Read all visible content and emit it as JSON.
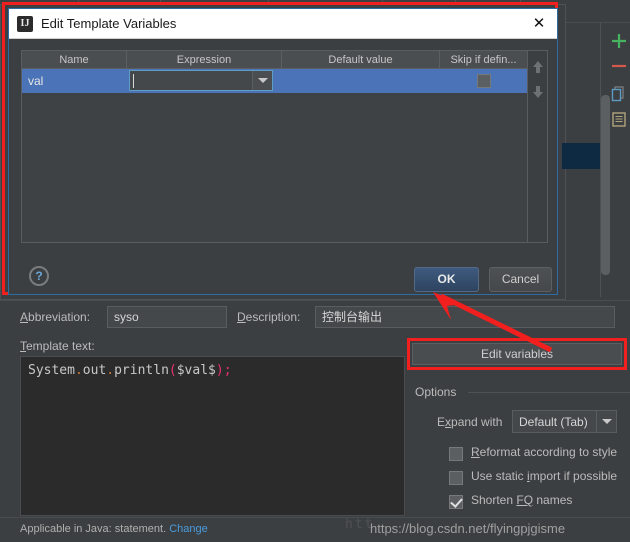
{
  "dialog": {
    "title": "Edit Template Variables",
    "app_icon": "IJ",
    "close_icon": "close-icon",
    "table": {
      "columns": [
        "Name",
        "Expression",
        "Default value",
        "Skip if defin..."
      ],
      "rows": [
        {
          "name": "val",
          "expression": "",
          "default_value": "",
          "skip_if_defined": false
        }
      ]
    },
    "side_buttons": [
      "move-up-arrow",
      "move-down-arrow"
    ],
    "help_label": "?",
    "ok_label": "OK",
    "cancel_label": "Cancel"
  },
  "form": {
    "abbreviation_label": "Abbreviation:",
    "abbreviation_value": "syso",
    "description_label": "Description:",
    "description_value": "控制台输出",
    "template_text_label": "Template text:",
    "template_code": {
      "part1": "System",
      "dot1": ".",
      "part2": "out",
      "dot2": ".",
      "part3": "println",
      "paren_open": "(",
      "variable": "$val$",
      "paren_close": ")",
      "semicolon": ";"
    },
    "edit_variables_label": "Edit variables"
  },
  "options": {
    "title": "Options",
    "expand_with_label": "Expand with",
    "expand_with_value": "Default (Tab)",
    "checkboxes": [
      {
        "label": "Reformat according to style",
        "checked": false
      },
      {
        "label": "Use static import if possible",
        "checked": false
      },
      {
        "label": "Shorten FQ names",
        "checked": true
      }
    ]
  },
  "footer": {
    "applicable_text": "Applicable in Java: statement.",
    "change_link": "Change"
  },
  "watermark": {
    "faint": "htt",
    "main": "https://blog.csdn.net/flyingpjgisme"
  },
  "toolbar": {
    "icons": [
      "add-icon",
      "remove-icon",
      "copy-icon",
      "document-icon"
    ]
  },
  "colors": {
    "annotation_red": "#f21f1f",
    "selection_blue": "#4b74b8",
    "accent_link": "#4a9bdc",
    "panel_bg": "#3c3f41",
    "editor_bg": "#2b2b2b"
  }
}
